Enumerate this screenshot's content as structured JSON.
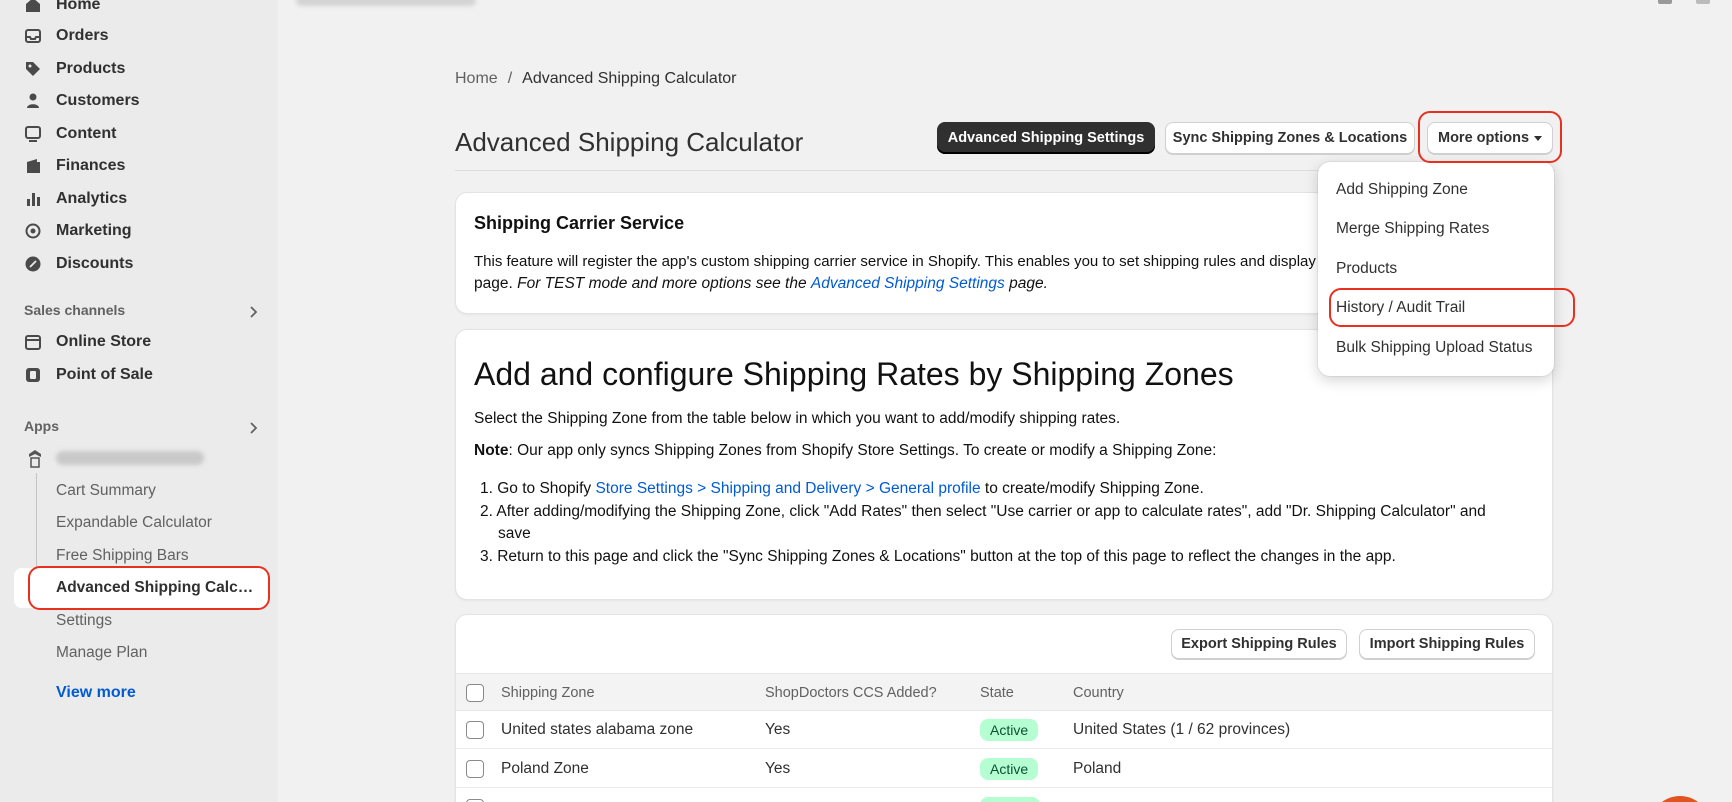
{
  "sidebar": {
    "nav": [
      {
        "label": "Home",
        "icon": "home-icon"
      },
      {
        "label": "Orders",
        "icon": "orders-icon"
      },
      {
        "label": "Products",
        "icon": "tag-icon"
      },
      {
        "label": "Customers",
        "icon": "person-icon"
      },
      {
        "label": "Content",
        "icon": "content-icon"
      },
      {
        "label": "Finances",
        "icon": "finances-icon"
      },
      {
        "label": "Analytics",
        "icon": "analytics-icon"
      },
      {
        "label": "Marketing",
        "icon": "marketing-icon"
      },
      {
        "label": "Discounts",
        "icon": "discount-icon"
      }
    ],
    "sales_channels_label": "Sales channels",
    "channels": [
      {
        "label": "Online Store",
        "icon": "store-icon"
      },
      {
        "label": "Point of Sale",
        "icon": "pos-icon"
      }
    ],
    "apps_label": "Apps",
    "app_sub_items": [
      "Cart Summary",
      "Expandable Calculator",
      "Free Shipping Bars"
    ],
    "active_item": "Advanced Shipping Calcu...",
    "app_sub_items_after": [
      "Settings",
      "Manage Plan"
    ],
    "view_more": "View more"
  },
  "breadcrumb": {
    "home": "Home",
    "separator": "/",
    "current": "Advanced Shipping Calculator"
  },
  "page_title": "Advanced Shipping Calculator",
  "header_buttons": {
    "settings": "Advanced Shipping Settings",
    "sync": "Sync Shipping Zones & Locations",
    "more": "More options"
  },
  "dropdown": {
    "items": [
      "Add Shipping Zone",
      "Merge Shipping Rates",
      "Products",
      "History / Audit Trail",
      "Bulk Shipping Upload Status"
    ]
  },
  "carrier_card": {
    "title": "Shipping Carrier Service",
    "text_line1": "This feature will register the app's custom shipping carrier service in Shopify. This enables you to set shipping rules and display t",
    "text_line2_prefix": "page.",
    "text_line2_italic": "For TEST mode and more options see the",
    "text_line2_link": "Advanced Shipping Settings",
    "text_line2_suffix": "page."
  },
  "config_card": {
    "heading": "Add and configure Shipping Rates by Shipping Zones",
    "intro": "Select the Shipping Zone from the table below in which you want to add/modify shipping rates.",
    "note_label": "Note",
    "note_text": ": Our app only syncs Shipping Zones from Shopify Store Settings. To create or modify a Shipping Zone:",
    "step1_prefix": "1. Go to Shopify",
    "step1_link": "Store Settings > Shipping and Delivery > General profile",
    "step1_suffix": "to create/modify Shipping Zone.",
    "step2": "2. After adding/modifying the Shipping Zone, click \"Add Rates\" then select \"Use carrier or app to calculate rates\", add \"Dr. Shipping Calculator\" and",
    "step2_cont": "save",
    "step3": "3. Return to this page and click the \"Sync Shipping Zones & Locations\" button at the top of this page to reflect the changes in the app."
  },
  "table_card": {
    "export_button": "Export Shipping Rules",
    "import_button": "Import Shipping Rules",
    "columns": [
      "Shipping Zone",
      "ShopDoctors CCS Added?",
      "State",
      "Country"
    ],
    "rows": [
      {
        "zone": "United states alabama zone",
        "ccs": "Yes",
        "state": "Active",
        "country": "United States (1 / 62 provinces)"
      },
      {
        "zone": "Poland Zone",
        "ccs": "Yes",
        "state": "Active",
        "country": "Poland"
      }
    ]
  },
  "colors": {
    "accent": "#005bd3",
    "highlight": "#e8301e",
    "active_badge": "#b4fed2"
  }
}
